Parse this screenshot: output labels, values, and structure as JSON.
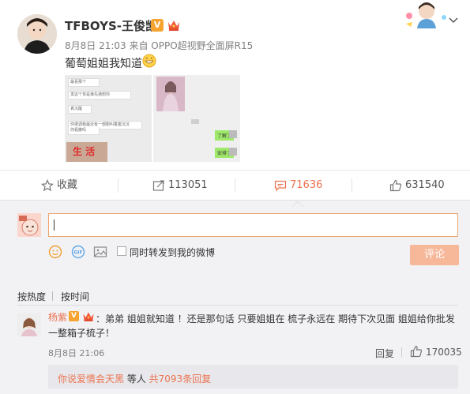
{
  "post": {
    "username": "TFBOYS-王俊凯",
    "verified_badge": "V",
    "meta": "8月8日 21:03 来自 OPPO超视野全面屏R15",
    "text": "葡萄姐姐我知道",
    "images": {
      "image1": {
        "chat_lines": [
          "最喜那个",
          "发这个背是谁先通想你",
          "真沉醒",
          "你很调我最近有一部剧叫香蜜沉沉",
          "你看撒吗"
        ],
        "sticker_text": "生 活"
      },
      "image2": {
        "green_bubbles": [
          "了解了",
          "安排了"
        ]
      }
    }
  },
  "actions": {
    "favorite": "收藏",
    "repost": "113051",
    "comment": "71636",
    "like": "631540"
  },
  "composer": {
    "input_value": "",
    "repost_option": "同时转发到我的微博",
    "repost_checked": false,
    "submit": "评论"
  },
  "sort": {
    "by_hot": "按热度",
    "by_time": "按时间"
  },
  "comment": {
    "user": "杨紫",
    "verified_badge": "V",
    "text_line1": "：弟弟 姐姐就知道 ！还是那句话 只要姐姐在 梳子永远在 期待下次见面 姐姐给你批发",
    "text_line2": "一整箱子梳子！",
    "time": "8月8日 21:06",
    "reply": "回复",
    "likes": "170035",
    "sub_reply": {
      "user": "你说爱情会天黑",
      "middle": " 等人 ",
      "count_text": "共7093条回复"
    }
  },
  "colors": {
    "accent": "#eb7350",
    "verified": "#f6a32f",
    "submit_disabled": "#f7b89a"
  }
}
